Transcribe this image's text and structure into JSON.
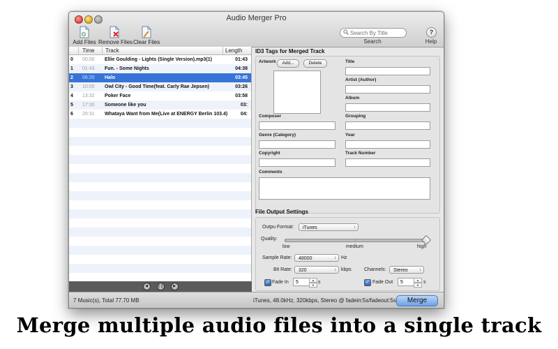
{
  "window": {
    "title": "Audio Merger Pro"
  },
  "toolbar": {
    "add_files": "Add Files",
    "remove_files": "Remove Files",
    "clear_files": "Clear Files",
    "search_placeholder": "Search By Title",
    "search_label": "Search",
    "help_symbol": "?",
    "help_label": "Help"
  },
  "track_list": {
    "columns": {
      "time": "Time",
      "track": "Track",
      "length": "Length"
    },
    "rows": [
      {
        "index": "0",
        "time": "00:00",
        "track": "Ellie Goulding - Lights (Single Version).mp3(1)",
        "length": "01:43",
        "selected": false
      },
      {
        "index": "1",
        "time": "01:43",
        "track": "Fun. - Some Nights",
        "length": "04:38",
        "selected": false
      },
      {
        "index": "2",
        "time": "06:20",
        "track": "Halo",
        "length": "03:45",
        "selected": true
      },
      {
        "index": "3",
        "time": "10:05",
        "track": "Owl City - Good Time(feat. Carly Rae Jepsen)",
        "length": "03:26",
        "selected": false
      },
      {
        "index": "4",
        "time": "13:32",
        "track": "Poker Face",
        "length": "03:58",
        "selected": false
      },
      {
        "index": "5",
        "time": "17:30",
        "track": "Someone like you",
        "length": "03:",
        "selected": false
      },
      {
        "index": "6",
        "time": "20:31",
        "track": "Whataya Want from Me(Live at ENERGY Berlin 103.4)",
        "length": "04:",
        "selected": false
      }
    ]
  },
  "id3": {
    "section_title": "ID3 Tags for Merged Track",
    "artwork_label": "Artwork",
    "add_button": "Add...",
    "delete_button": "Delete",
    "title_label": "Title",
    "artist_label": "Artist (Author)",
    "album_label": "Album",
    "composer_label": "Composer",
    "grouping_label": "Grouping",
    "genre_label": "Genre (Category)",
    "year_label": "Year",
    "copyright_label": "Copyright",
    "track_number_label": "Track Number",
    "comments_label": "Comments"
  },
  "output": {
    "section_title": "File Output Settings",
    "format_label": "Outpu Format:",
    "format_value": "iTunes",
    "quality_label": "Quality:",
    "quality_low": "low",
    "quality_medium": "medium",
    "quality_high": "high",
    "quality_level": 1.0,
    "sample_rate_label": "Sample Rate:",
    "sample_rate_value": "48000",
    "sample_rate_unit": "Hz",
    "bit_rate_label": "Bit Rate:",
    "bit_rate_value": "320",
    "bit_rate_unit": "kbps",
    "channels_label": "Channels:",
    "channels_value": "Stereo",
    "fade_in_label": "Fade In",
    "fade_in_value": "5",
    "fade_out_label": "Fade Out",
    "fade_out_value": "5",
    "seconds_unit": "s"
  },
  "status": {
    "summary": "7 Music(s), Total 77.70 MB",
    "format_summary": "iTunes, 48.0kHz, 320kbps, Stereo @ fadein:5s/fadeout:5s",
    "merge_button": "Merge"
  },
  "caption": "Merge multiple audio files into a single track"
}
